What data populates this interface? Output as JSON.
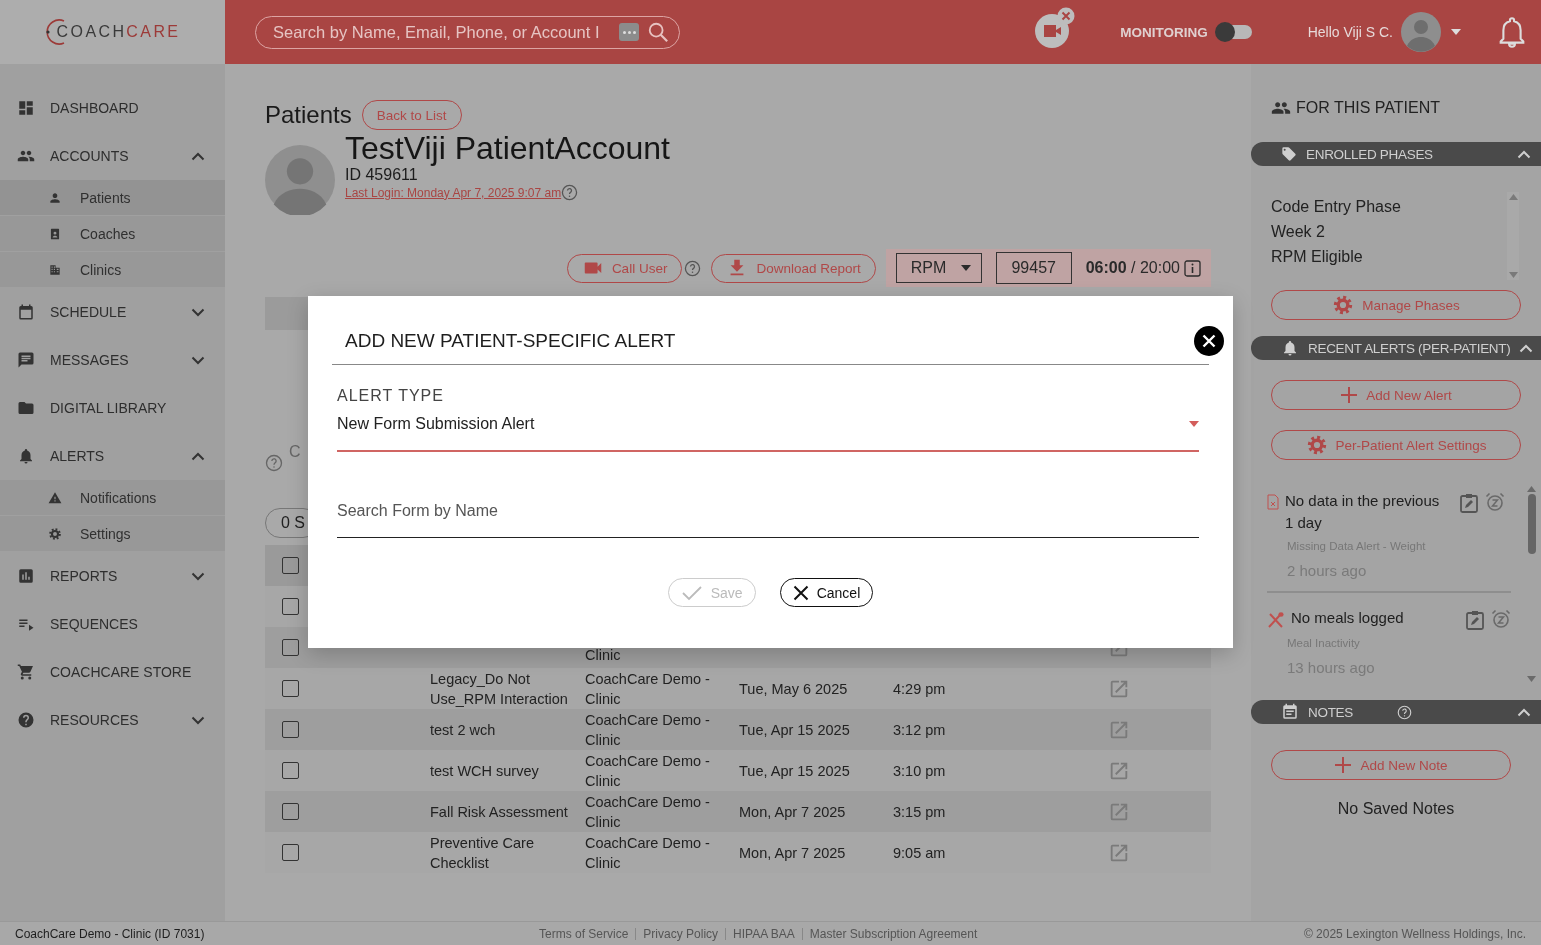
{
  "header": {
    "logo": [
      "COACH",
      "CARE"
    ],
    "search": {
      "placeholder": "Search by Name, Email, Phone, or Account I"
    },
    "monitoring": {
      "label": "MONITORING",
      "on": false
    },
    "greeting": "Hello Viji S C."
  },
  "sidebar": {
    "items": [
      {
        "label": "DASHBOARD"
      },
      {
        "label": "ACCOUNTS",
        "expanded": true,
        "children": [
          {
            "label": "Patients",
            "selected": true
          },
          {
            "label": "Coaches",
            "selected": false
          },
          {
            "label": "Clinics",
            "selected": false
          }
        ]
      },
      {
        "label": "SCHEDULE",
        "expanded": false
      },
      {
        "label": "MESSAGES",
        "expanded": false
      },
      {
        "label": "DIGITAL LIBRARY"
      },
      {
        "label": "ALERTS",
        "expanded": true,
        "children": [
          {
            "label": "Notifications",
            "selected": false
          },
          {
            "label": "Settings",
            "selected": false
          }
        ]
      },
      {
        "label": "REPORTS",
        "expanded": false
      },
      {
        "label": "SEQUENCES"
      },
      {
        "label": "COACHCARE STORE"
      },
      {
        "label": "RESOURCES",
        "expanded": false
      }
    ]
  },
  "main": {
    "title": "Patients",
    "back_button": "Back to List",
    "patient": {
      "name": "TestViji PatientAccount",
      "id": "ID 459611",
      "last_login": "Last Login: Monday Apr 7, 2025 9:07 am"
    },
    "actions": {
      "call": "Call User",
      "download": "Download Report",
      "program": "RPM",
      "code": "99457",
      "timer": "**06:00** / 20:00"
    },
    "partial_label": "C",
    "selection_pill": "0 S",
    "table": {
      "select_all": {
        "checked": false
      },
      "rows": [
        {
          "checked": false
        },
        {
          "checked": false,
          "clinic": "Clinic"
        },
        {
          "checked": false,
          "name": "Legacy_Do Not Use_RPM Interaction",
          "clinic": "CoachCare Demo - Clinic",
          "date": "Tue, May 6 2025",
          "time": "4:29 pm"
        },
        {
          "checked": false,
          "name": "test 2 wch",
          "clinic": "CoachCare Demo - Clinic",
          "date": "Tue, Apr 15 2025",
          "time": "3:12 pm"
        },
        {
          "checked": false,
          "name": "test WCH survey",
          "clinic": "CoachCare Demo - Clinic",
          "date": "Tue, Apr 15 2025",
          "time": "3:10 pm"
        },
        {
          "checked": false,
          "name": "Fall Risk Assessment",
          "clinic": "CoachCare Demo - Clinic",
          "date": "Mon, Apr 7 2025",
          "time": "3:15 pm"
        },
        {
          "checked": false,
          "name": "Preventive Care Checklist",
          "clinic": "CoachCare Demo - Clinic",
          "date": "Mon, Apr 7 2025",
          "time": "9:05 am"
        }
      ]
    }
  },
  "right_panel": {
    "title": "FOR THIS PATIENT",
    "phases": {
      "title": "ENROLLED PHASES",
      "expanded": true,
      "items": [
        "Code Entry Phase",
        "Week 2",
        "RPM Eligible"
      ],
      "button": "Manage Phases"
    },
    "alerts": {
      "title": "RECENT ALERTS (PER-PATIENT)",
      "expanded": true,
      "add_button": "Add New Alert",
      "settings_button": "Per-Patient Alert Settings",
      "items": [
        {
          "kind": "missing-data",
          "title": "No data in the previous 1 day",
          "type": "Missing Data Alert - Weight",
          "time": "2 hours ago"
        },
        {
          "kind": "meal",
          "title": "No meals logged",
          "type": "Meal Inactivity",
          "time": "13 hours ago"
        }
      ]
    },
    "notes": {
      "title": "NOTES",
      "expanded": true,
      "add_button": "Add New Note",
      "empty": "No Saved Notes"
    }
  },
  "dialog": {
    "title": "ADD NEW PATIENT-SPECIFIC ALERT",
    "field_label": "ALERT TYPE",
    "alert_type": "New Form Submission Alert",
    "search_placeholder": "Search Form by Name",
    "save": {
      "label": "Save",
      "disabled": true
    },
    "cancel": "Cancel"
  },
  "footer": {
    "clinic": "CoachCare Demo - Clinic (ID 7031)",
    "links": [
      "Terms of Service",
      "Privacy Policy",
      "HIPAA BAA",
      "Master Subscription Agreement"
    ],
    "copyright": "© 2025 Lexington Wellness Holdings, Inc."
  }
}
